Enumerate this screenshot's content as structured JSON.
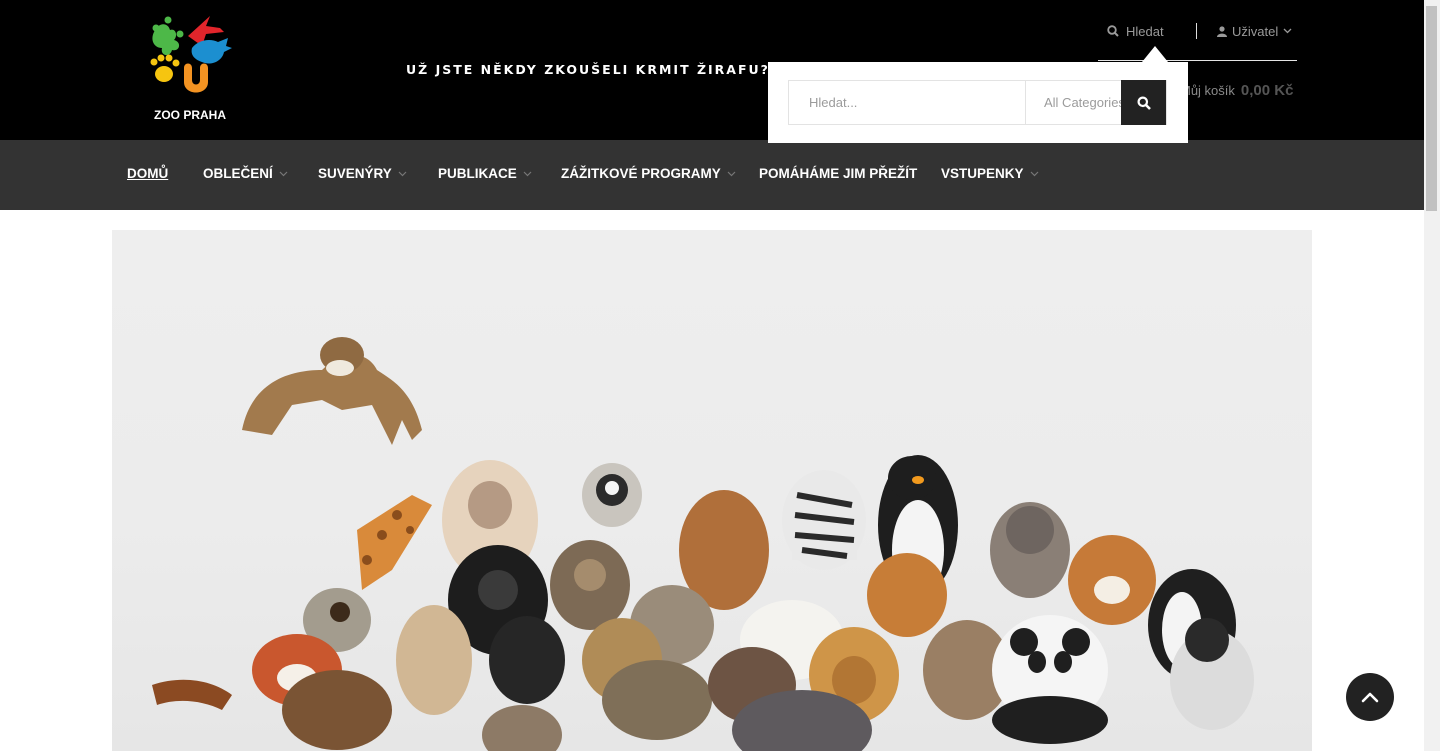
{
  "header": {
    "logo_text": "ZOO PRAHA",
    "tagline": "UŽ JSTE NĚKDY ZKOUŠELI KRMIT ŽIRAFU?",
    "search_label": "Hledat",
    "user_label": "Uživatel",
    "cart_label": "Můj košík",
    "cart_total": "0,00 Kč"
  },
  "search": {
    "placeholder": "Hledat...",
    "category": "All Categories"
  },
  "nav": {
    "items": [
      {
        "label": "DOMŮ"
      },
      {
        "label": "OBLEČENÍ"
      },
      {
        "label": "SUVENÝRY"
      },
      {
        "label": "PUBLIKACE"
      },
      {
        "label": "ZÁŽITKOVÉ PROGRAMY"
      },
      {
        "label": "POMÁHÁME JIM PŘEŽÍT"
      },
      {
        "label": "VSTUPENKY"
      }
    ]
  },
  "hero": {
    "image": "plush-animals-photo"
  },
  "icons": {
    "search": "search-icon",
    "user": "user-icon",
    "up": "arrow-up-icon"
  }
}
